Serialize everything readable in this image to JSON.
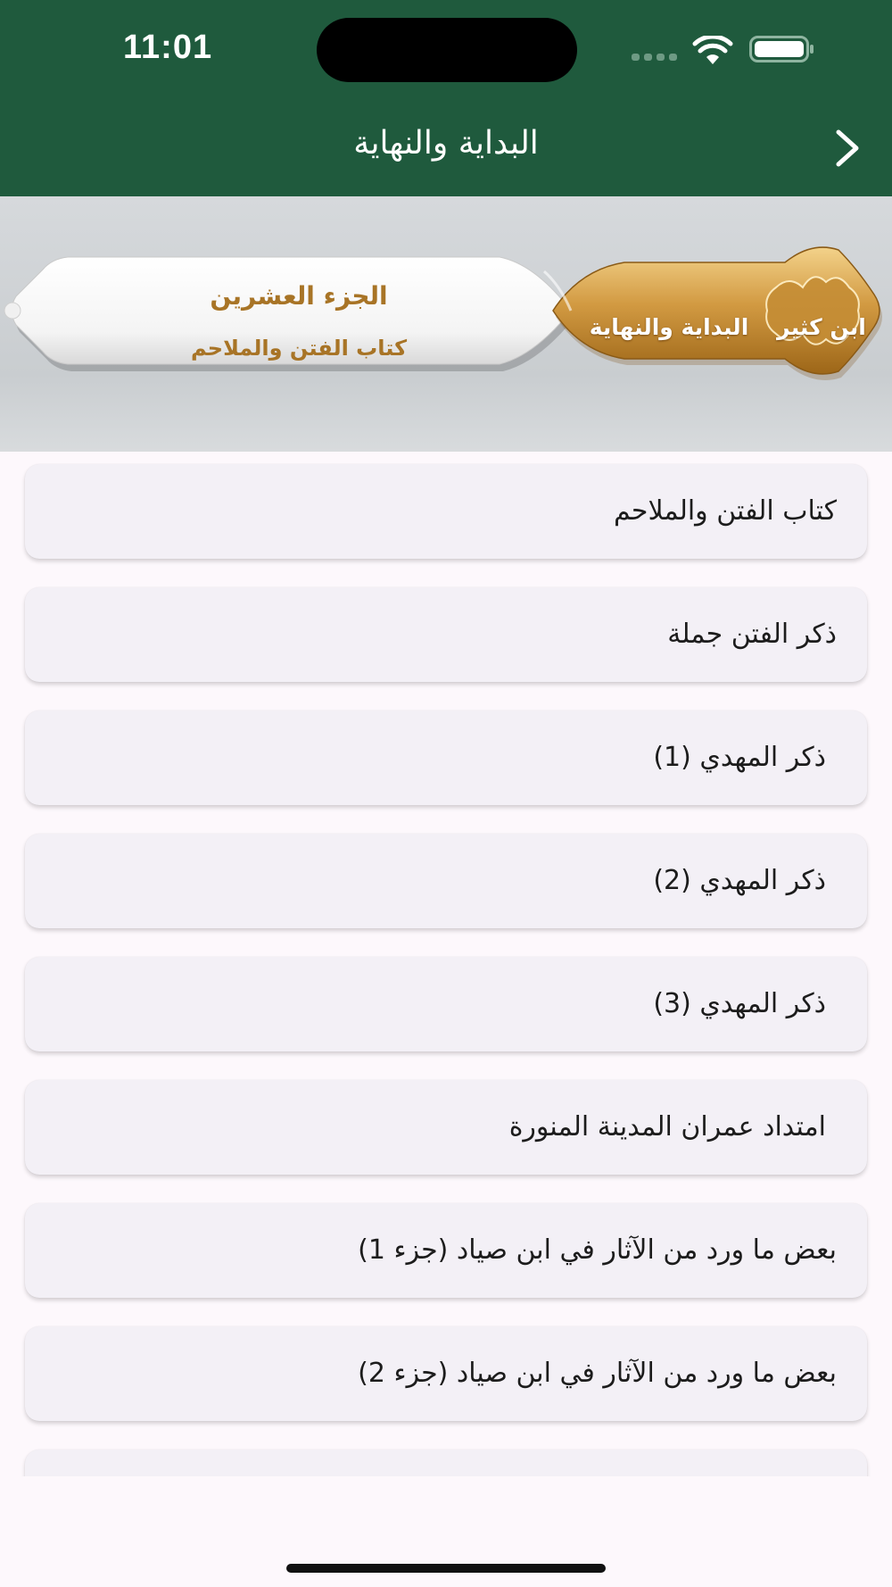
{
  "status_bar": {
    "time": "11:01"
  },
  "nav": {
    "title": "البداية والنهاية",
    "back_icon": "chevron-right-icon"
  },
  "banner": {
    "volume_title": "الجزء العشرين",
    "volume_subtitle": "كتاب الفتن والملاحم",
    "book_title": "البداية والنهاية",
    "author": "ابن كثير"
  },
  "chapters": [
    {
      "label": "كتاب الفتن والملاحم"
    },
    {
      "label": "ذكر الفتن جملة"
    },
    {
      "label": "ذكر المهدي (1)"
    },
    {
      "label": "ذكر المهدي (2)"
    },
    {
      "label": "ذكر المهدي (3)"
    },
    {
      "label": "امتداد عمران المدينة المنورة"
    },
    {
      "label": "بعض ما ورد من الآثار في ابن صياد (جزء 1)"
    },
    {
      "label": "بعض ما ورد من الآثار في ابن صياد (جزء 2)"
    },
    {
      "label": ""
    }
  ],
  "colors": {
    "header": "#1f5a3d",
    "gold": "#a87426",
    "card": "#f3f0f6",
    "background": "#fdf8fc"
  }
}
